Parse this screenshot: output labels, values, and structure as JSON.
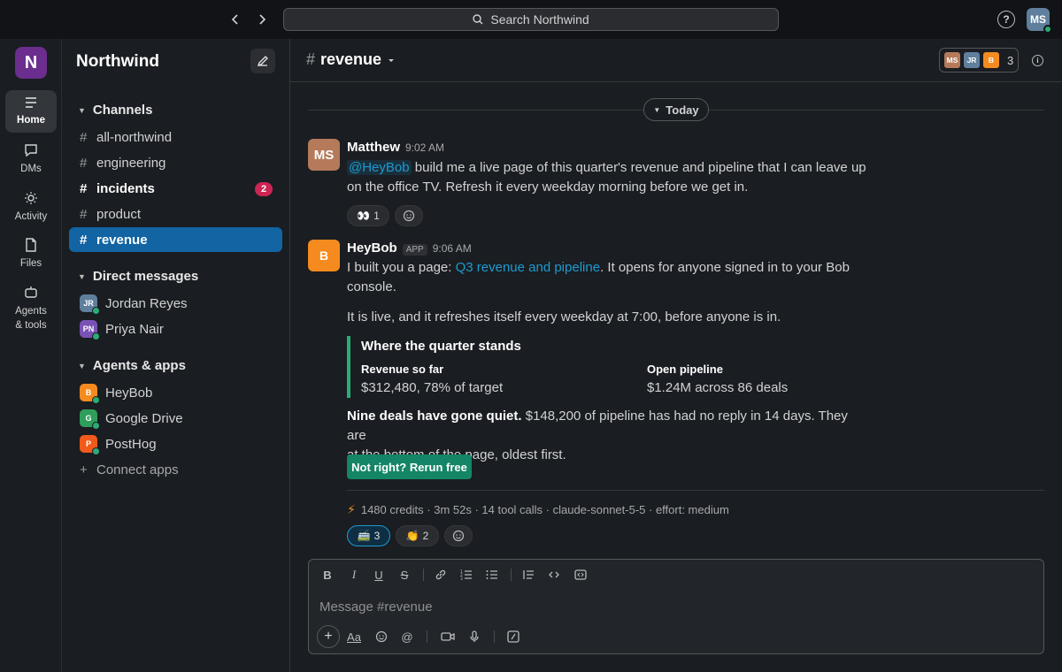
{
  "topbar": {
    "back_icon": "chevron-left-icon",
    "forward_icon": "chevron-right-icon",
    "search_label": "Search Northwind",
    "help_label": "?",
    "user_initials": "MS"
  },
  "rail": {
    "workspace_initial": "N",
    "items": [
      {
        "label": "Home",
        "icon": "home-icon",
        "active": true
      },
      {
        "label": "DMs",
        "icon": "chat-bubble-icon"
      },
      {
        "label": "Activity",
        "icon": "bell-icon"
      },
      {
        "label": "Files",
        "icon": "file-icon"
      },
      {
        "label": "Agents\n& tools",
        "icon": "robot-icon"
      }
    ],
    "agents_line1": "Agents",
    "agents_line2": "& tools"
  },
  "sidebar": {
    "workspace_name": "Northwind",
    "channels_header": "Channels",
    "channels": [
      {
        "name": "all-northwind"
      },
      {
        "name": "engineering"
      },
      {
        "name": "incidents",
        "unread": "2"
      },
      {
        "name": "product"
      },
      {
        "name": "revenue",
        "active": true
      }
    ],
    "dm_header": "Direct messages",
    "dms": [
      {
        "initials": "JR",
        "name": "Jordan Reyes",
        "color": "#5f7f9c"
      },
      {
        "initials": "PN",
        "name": "Priya Nair",
        "color": "#7a52b5"
      }
    ],
    "apps_header": "Agents & apps",
    "apps": [
      {
        "initials": "B",
        "name": "HeyBob",
        "color": "#f58a1f"
      },
      {
        "initials": "G",
        "name": "Google Drive",
        "color": "#2f9e5b"
      },
      {
        "initials": "P",
        "name": "PostHog",
        "color": "#f05a1a"
      }
    ],
    "connect_label": "Connect apps"
  },
  "channel": {
    "name": "revenue",
    "member_initials": [
      "MS",
      "JR",
      "B"
    ],
    "member_count": "3",
    "day_label": "Today"
  },
  "messages": [
    {
      "initials": "MS",
      "author": "Matthew",
      "time": "9:02 AM",
      "mention": "@HeyBob",
      "text_line1": " build me a live page of this quarter's revenue and pipeline that I can leave up",
      "text_line2": "on the office TV. Refresh it every weekday morning before we get in.",
      "reactions": [
        {
          "emoji": "👀",
          "count": "1"
        }
      ]
    },
    {
      "initials": "B",
      "author": "HeyBob",
      "app_tag": "APP",
      "time": "9:06 AM",
      "p1_prefix": "I built you a page: ",
      "p1_link": "Q3 revenue and pipeline",
      "p1_suffix": ". It opens for anyone signed in to your Bob",
      "p1_line2": "console.",
      "p2": "It is live, and it refreshes itself every weekday at 7:00, before anyone is in.",
      "quote_title": "Where the quarter stands",
      "field1_label": "Revenue so far",
      "field1_value": "$312,480, 78% of target",
      "field2_label": "Open pipeline",
      "field2_value": "$1.24M across 86 deals",
      "p3_bold": "Nine deals have gone quiet.",
      "p3_rest": " $148,200 of pipeline has had no reply in 14 days. They are",
      "p3_line2": "at the bottom of the page, oldest first.",
      "button_label": "Not right? Rerun free",
      "meta": "1480 credits · 3m 52s · 14 tool calls · claude-sonnet-5-5 · effort: medium",
      "reactions": [
        {
          "emoji": "🚎",
          "count": "3",
          "mine": true
        },
        {
          "emoji": "👏",
          "count": "2"
        }
      ]
    }
  ],
  "composer": {
    "placeholder": "Message #revenue",
    "format_bold": "B",
    "format_italic": "I",
    "format_underline": "U",
    "format_strike": "S",
    "text_style_label": "Aa"
  },
  "colors": {
    "accent": "#1264a3",
    "link": "#1d9bd1",
    "online": "#2bac76",
    "button": "#148567",
    "badge": "#cd2553"
  }
}
